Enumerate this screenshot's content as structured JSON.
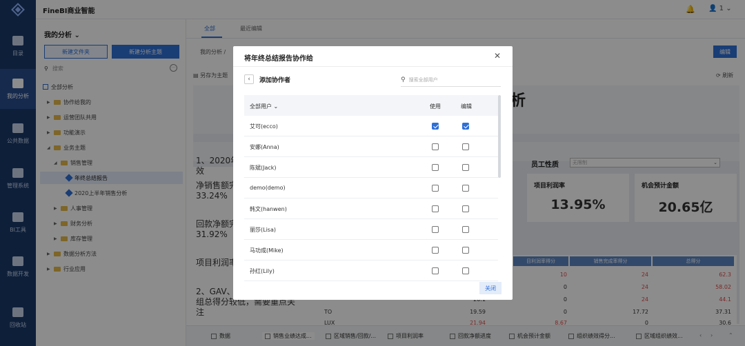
{
  "app": {
    "title": "FineBI商业智能",
    "user_label": "1"
  },
  "rail": [
    {
      "label": "目录"
    },
    {
      "label": "我的分析"
    },
    {
      "label": "公共数据"
    },
    {
      "label": "管理系统"
    },
    {
      "label": "BI工具"
    },
    {
      "label": "数据开发"
    },
    {
      "label": "回收站"
    }
  ],
  "panel": {
    "title": "我的分析",
    "new_folder": "新建文件夹",
    "new_subject": "新建分析主题",
    "search_placeholder": "搜索",
    "tree": [
      {
        "label": "全部分析"
      },
      {
        "label": "协作给我的"
      },
      {
        "label": "运营团队共用"
      },
      {
        "label": "功能演示"
      },
      {
        "label": "业务主题"
      },
      {
        "label": "销售管理"
      },
      {
        "label": "年终总结报告"
      },
      {
        "label": "2020上半年销售分析"
      },
      {
        "label": "人事管理"
      },
      {
        "label": "财务分析"
      },
      {
        "label": "库存管理"
      },
      {
        "label": "数据分析方法"
      },
      {
        "label": "行业应用"
      }
    ]
  },
  "main": {
    "tabs": [
      "全部",
      "最近编辑"
    ],
    "breadcrumb": "我的分析 /",
    "edit": "编辑",
    "save_as": "另存为主题",
    "refresh": "刷新",
    "big_title_fragment": "析",
    "text_1a": "1、2020年",
    "text_1b": "效",
    "text_2a": "净销售额完",
    "text_2b": "33.24%",
    "text_3a": "回款净额完",
    "text_3b": "31.92%",
    "text_4": "项目利润率",
    "text_5a": "2、GAV、",
    "text_5b": "组总得分较低，需要重点关",
    "text_5c": "注",
    "filter_label": "员工性质",
    "filter_value": "无限制",
    "kpis": [
      {
        "label": "项目利润率",
        "value": "13.95%"
      },
      {
        "label": "机会预计金额",
        "value": "20.65亿"
      }
    ],
    "table_headers": [
      "目利润率得分",
      "销售完成率得分",
      "总得分"
    ],
    "table_rows": [
      {
        "c1": "",
        "c2": "10",
        "c3": "24",
        "c4": "62.3"
      },
      {
        "c1": "",
        "c2": "0",
        "c3": "24",
        "c4": "58.02"
      },
      {
        "c1": "20.1",
        "c2": "0",
        "c3": "24",
        "c4": "44.1"
      },
      {
        "c1": "TO",
        "c0": "19.59",
        "c2": "0",
        "c3": "17.72",
        "c4": "37.31"
      },
      {
        "c1": "LUX",
        "c0": "21.94",
        "c2": "8.67",
        "c3": "0",
        "c4": "30.6"
      }
    ],
    "bottom_tabs": [
      "数据",
      "销售业绩达成...",
      "区域销售/回款/...",
      "项目利润率",
      "回款净额进度",
      "机会预计金额",
      "组织绩效得分...",
      "区域组织绩效..."
    ]
  },
  "modal": {
    "title": "将年终总结报告协作给",
    "sub_title": "添加协作者",
    "search_placeholder": "搜索全部用户",
    "col_all": "全部用户",
    "col_use": "使用",
    "col_edit": "编辑",
    "close_label": "关闭",
    "users": [
      {
        "name": "艾可(ecco)",
        "use": true,
        "edit": true
      },
      {
        "name": "安娜(Anna)",
        "use": false,
        "edit": false
      },
      {
        "name": "陈斌(Jack)",
        "use": false,
        "edit": false
      },
      {
        "name": "demo(demo)",
        "use": false,
        "edit": false
      },
      {
        "name": "韩文(hanwen)",
        "use": false,
        "edit": false
      },
      {
        "name": "丽莎(Lisa)",
        "use": false,
        "edit": false
      },
      {
        "name": "马功成(Mike)",
        "use": false,
        "edit": false
      },
      {
        "name": "孙红(Lily)",
        "use": false,
        "edit": false
      }
    ]
  }
}
